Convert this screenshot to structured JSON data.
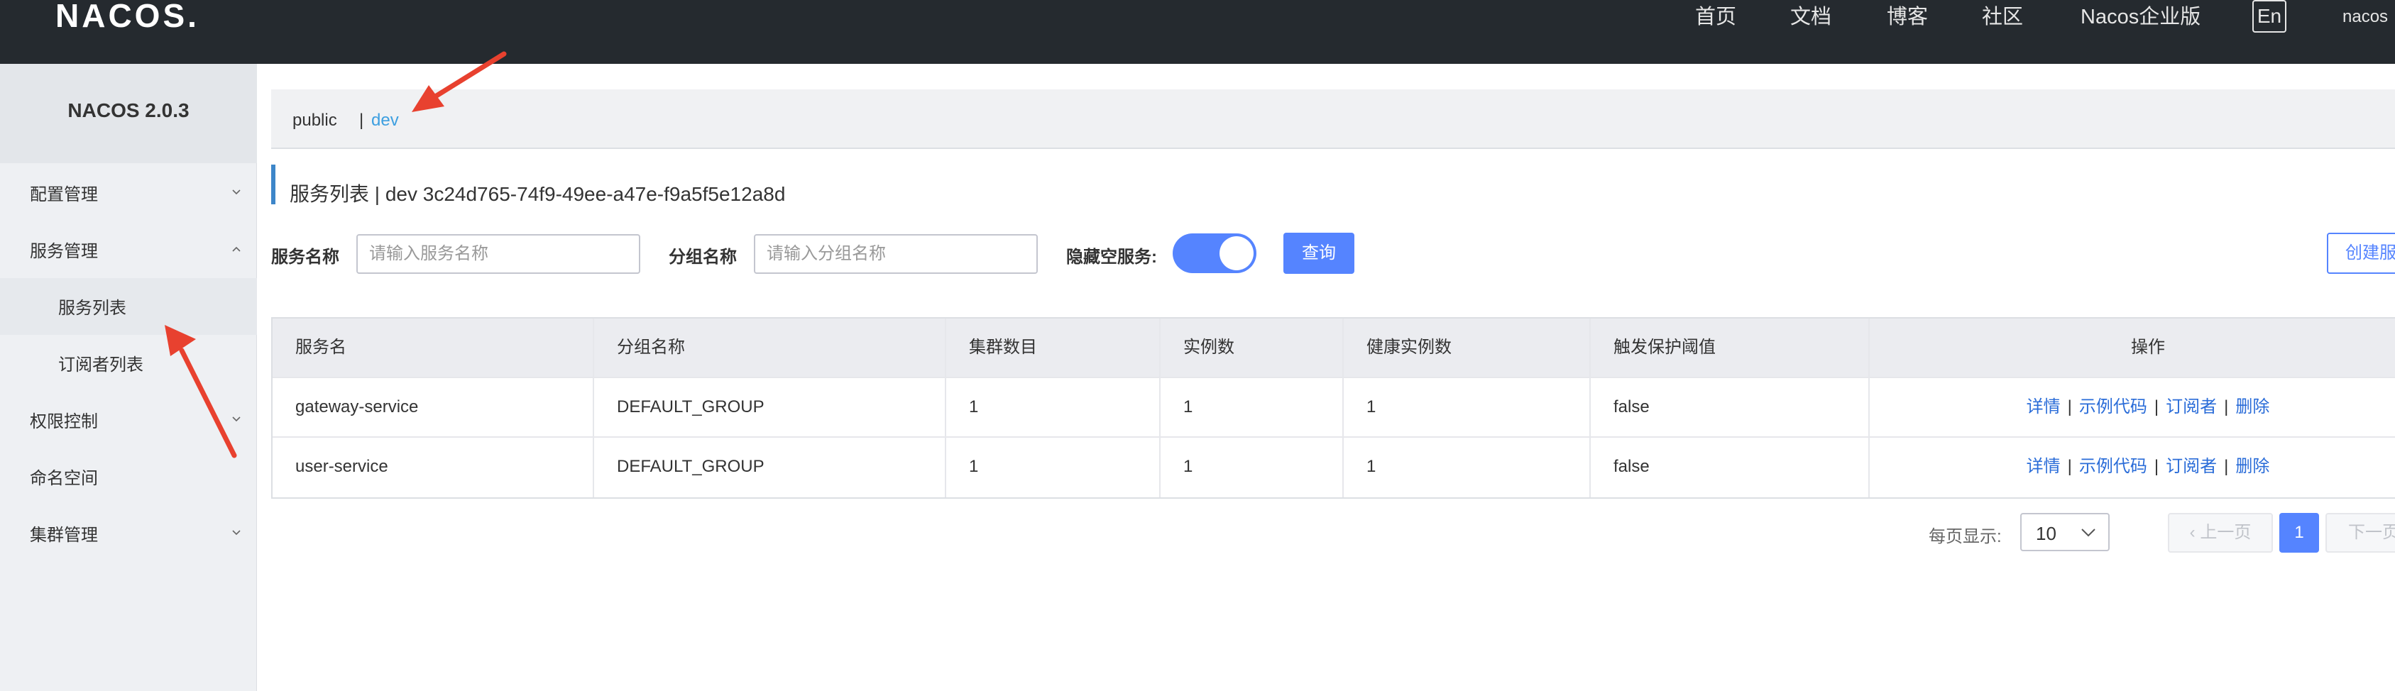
{
  "topbar": {
    "logo": "NACOS.",
    "nav": [
      "首页",
      "文档",
      "博客",
      "社区",
      "Nacos企业版"
    ],
    "lang": "En",
    "user": "nacos"
  },
  "sidebar": {
    "title": "NACOS 2.0.3",
    "items": [
      {
        "label": "配置管理",
        "chevron": "down"
      },
      {
        "label": "服务管理",
        "chevron": "up"
      },
      {
        "label": "服务列表"
      },
      {
        "label": "订阅者列表"
      },
      {
        "label": "权限控制",
        "chevron": "down"
      },
      {
        "label": "命名空间"
      },
      {
        "label": "集群管理",
        "chevron": "down"
      }
    ]
  },
  "namespaces": {
    "public": "public",
    "separator": "|",
    "dev": "dev"
  },
  "page": {
    "title": "服务列表  |  dev  3c24d765-74f9-49ee-a47e-f9a5f5e12a8d"
  },
  "filters": {
    "service_name_label": "服务名称",
    "service_name_placeholder": "请输入服务名称",
    "group_name_label": "分组名称",
    "group_name_placeholder": "请输入分组名称",
    "hide_empty_label": "隐藏空服务:",
    "hide_empty_on": true,
    "query_label": "查询",
    "create_label": "创建服务"
  },
  "table": {
    "headers": [
      "服务名",
      "分组名称",
      "集群数目",
      "实例数",
      "健康实例数",
      "触发保护阈值",
      "操作"
    ],
    "rows": [
      [
        "gateway-service",
        "DEFAULT_GROUP",
        "1",
        "1",
        "1",
        "false"
      ],
      [
        "user-service",
        "DEFAULT_GROUP",
        "1",
        "1",
        "1",
        "false"
      ]
    ],
    "actions": [
      "详情",
      "示例代码",
      "订阅者",
      "删除"
    ]
  },
  "pagination": {
    "per_page_label": "每页显示:",
    "per_page_value": "10",
    "prev_label": "上一页",
    "current_page": "1",
    "next_label": "下一页"
  },
  "colors": {
    "topbar_bg": "#252a2f",
    "primary": "#5584ff",
    "link": "#2a6cd8",
    "annotation_arrow": "#e8412f"
  }
}
